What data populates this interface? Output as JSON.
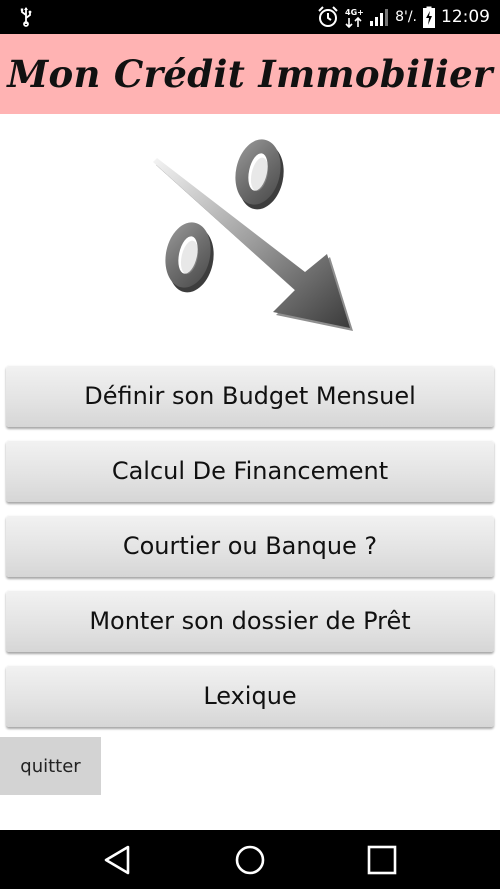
{
  "status_bar": {
    "time": "12:09",
    "battery_percent": "8'/.",
    "network_label": "4G+",
    "icons": [
      "usb-icon",
      "alarm-icon",
      "network-4g-icon",
      "signal-icon",
      "battery-charging-icon"
    ]
  },
  "app": {
    "title": "Mon Crédit Immobilier",
    "header_color": "#ffb3b3"
  },
  "illustration": {
    "icon": "percent-down-arrow-icon"
  },
  "menu": {
    "items": [
      {
        "label": "Définir son Budget Mensuel"
      },
      {
        "label": "Calcul De Financement"
      },
      {
        "label": "Courtier ou Banque ?"
      },
      {
        "label": "Monter son dossier de Prêt"
      },
      {
        "label": "Lexique"
      }
    ],
    "quit_label": "quitter"
  },
  "nav_bar": {
    "icons": [
      "back-icon",
      "home-icon",
      "recents-icon"
    ]
  }
}
